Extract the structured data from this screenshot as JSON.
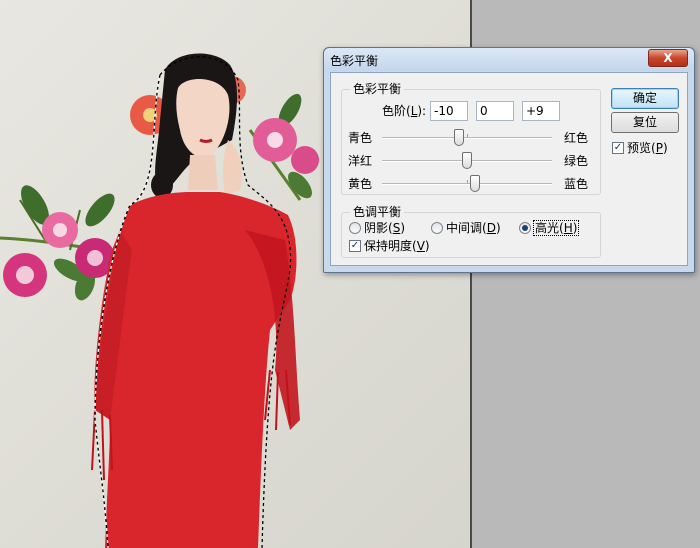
{
  "dialog": {
    "title": "色彩平衡",
    "close_label": "X",
    "color_balance_group": {
      "legend": "色彩平衡",
      "levels_label": "色阶(L):",
      "levels_values": [
        "-10",
        "0",
        "+9"
      ],
      "sliders": [
        {
          "left": "青色",
          "right": "红色",
          "value": -10
        },
        {
          "left": "洋红",
          "right": "绿色",
          "value": 0
        },
        {
          "left": "黄色",
          "right": "蓝色",
          "value": 9
        }
      ]
    },
    "tone_balance_group": {
      "legend": "色调平衡",
      "options": [
        {
          "label": "阴影(S)",
          "selected": false
        },
        {
          "label": "中间调(D)",
          "selected": false
        },
        {
          "label": "高光(H)",
          "selected": true
        }
      ],
      "preserve_luminosity": {
        "label": "保持明度(V)",
        "checked": true
      }
    },
    "buttons": {
      "ok": "确定",
      "reset": "复位"
    },
    "preview": {
      "label": "预览(P)",
      "checked": true
    }
  },
  "colors": {
    "dialog_frame": "#c8d9ee",
    "dress_red": "#d9262c",
    "canvas_bg": "#e3e2db",
    "outside_canvas": "#b9b9b9"
  }
}
